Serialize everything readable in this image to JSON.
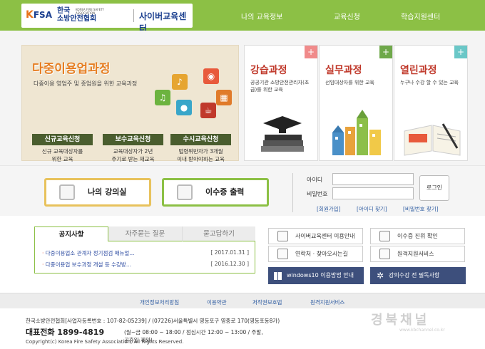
{
  "header": {
    "logo_k": "K",
    "logo_fsa": "FSA",
    "org_name_1": "한국",
    "org_name_2": "소방안전협회",
    "org_en_1": "KOREA FIRE SAFETY",
    "org_en_2": "ASSOCIATION",
    "site_name": "사이버교육센터",
    "nav": [
      "나의 교육정보",
      "교육신청",
      "학습지원센터"
    ]
  },
  "main_course": {
    "title": "다중이용업과정",
    "desc": "다중이용 영업주 및 종업원을 위한 교육과정",
    "subs": [
      {
        "label": "신규교육신청",
        "desc1": "신규 교육대상자를",
        "desc2": "위한 교육"
      },
      {
        "label": "보수교육신청",
        "desc1": "교육대상자가 2년",
        "desc2": "주기로 받는 재교육"
      },
      {
        "label": "수시교육신청",
        "desc1": "법령위반자가 3개월",
        "desc2": "이내 받아야하는 교육"
      }
    ],
    "icons": [
      "microphone-icon",
      "music-note-icon",
      "film-reel-icon",
      "dining-icon",
      "coffee-cup-icon",
      "building-icon"
    ]
  },
  "cards": [
    {
      "title": "강습과정",
      "desc": "공공기관 소방안전관리자(초급)를 위한 교육",
      "plus": "+",
      "accent": "#f08a8a",
      "title_color": "#c0392b"
    },
    {
      "title": "실무과정",
      "desc": "선임대상자를 위한 교육",
      "plus": "+",
      "accent": "#6fa84a",
      "title_color": "#c0392b"
    },
    {
      "title": "열린과정",
      "desc": "누구나 수강 할 수 있는 교육",
      "plus": "+",
      "accent": "#6ac7c7",
      "title_color": "#c0392b"
    }
  ],
  "quick": {
    "lecture_room": "나의 강의실",
    "certificate": "이수증 출력"
  },
  "login": {
    "id_label": "아이디",
    "pw_label": "비밀번호",
    "button": "로그인",
    "links": [
      "[회원가입]",
      "[아이디 찾기]",
      "[비밀번호 찾기]"
    ]
  },
  "board": {
    "tabs": [
      "공지사항",
      "자주묻는 질문",
      "묻고답하기"
    ],
    "rows": [
      {
        "title": "다중이용업소 관계자 정기점검 매뉴얼...",
        "date": "[ 2017.01.31 ]"
      },
      {
        "title": "다중이용업 보수과정 개설 등 수강방...",
        "date": "[ 2016.12.30 ]"
      }
    ]
  },
  "services": [
    {
      "label": "사이버교육센터 이용안내",
      "icon": "monitor-icon"
    },
    {
      "label": "이수증 진위 확인",
      "icon": "id-card-icon"
    },
    {
      "label": "연락처 · 찾아오시는길",
      "icon": "phone-icon"
    },
    {
      "label": "원격지원서비스",
      "icon": "remote-screen-icon"
    }
  ],
  "dark_buttons": [
    {
      "label": "windows10 이용방법 안내",
      "icon": "windows-icon"
    },
    {
      "label": "강의수강 전 필독사항",
      "icon": "gear-icon"
    }
  ],
  "footer": {
    "links": [
      "개인정보처리방침",
      "이용약관",
      "저작권보호법",
      "원격지원서비스"
    ],
    "address": "한국소방안전협회[사업자등록번호 : 107-82-05239]  /  (07226)서울특별시 영등포구 영중로 170(영등포동8가)",
    "tel_label": "대표전화  1899-4819",
    "hours": "(월~금 08:00 ~ 18:00 / 점심시간 12:00 ~ 13:00 / 주말,공휴일 제외)",
    "copyright": "Copyright(c) Korea Fire Safety Association, All Rights Reserved."
  },
  "watermark": {
    "text": "경북채널",
    "sub": "www.kbchannel.co.kr"
  },
  "colors": {
    "header": "#8cc045",
    "accent_orange": "#e67e22",
    "navy": "#3d4f7c"
  }
}
